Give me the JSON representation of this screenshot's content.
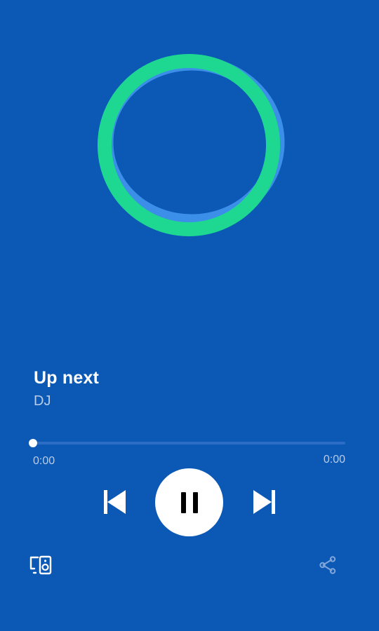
{
  "colors": {
    "background": "#0B58B5",
    "ring_primary": "#1ED891",
    "ring_shadow": "#3C8FE8",
    "text_primary": "#FFFFFF",
    "text_secondary": "#B8CDEB",
    "progress_track": "#2C6CC4",
    "share_icon": "#7FA6DB"
  },
  "artwork": {
    "icon": "dj-ring-icon"
  },
  "track": {
    "title": "Up next",
    "artist": "DJ"
  },
  "playback": {
    "progress_fraction": 0.0,
    "elapsed": "0:00",
    "total": "0:00",
    "state": "playing"
  },
  "controls": {
    "previous_icon": "skip-previous-icon",
    "pause_icon": "pause-icon",
    "next_icon": "skip-next-icon"
  },
  "footer": {
    "devices_icon": "connect-device-icon",
    "share_icon": "share-icon"
  }
}
